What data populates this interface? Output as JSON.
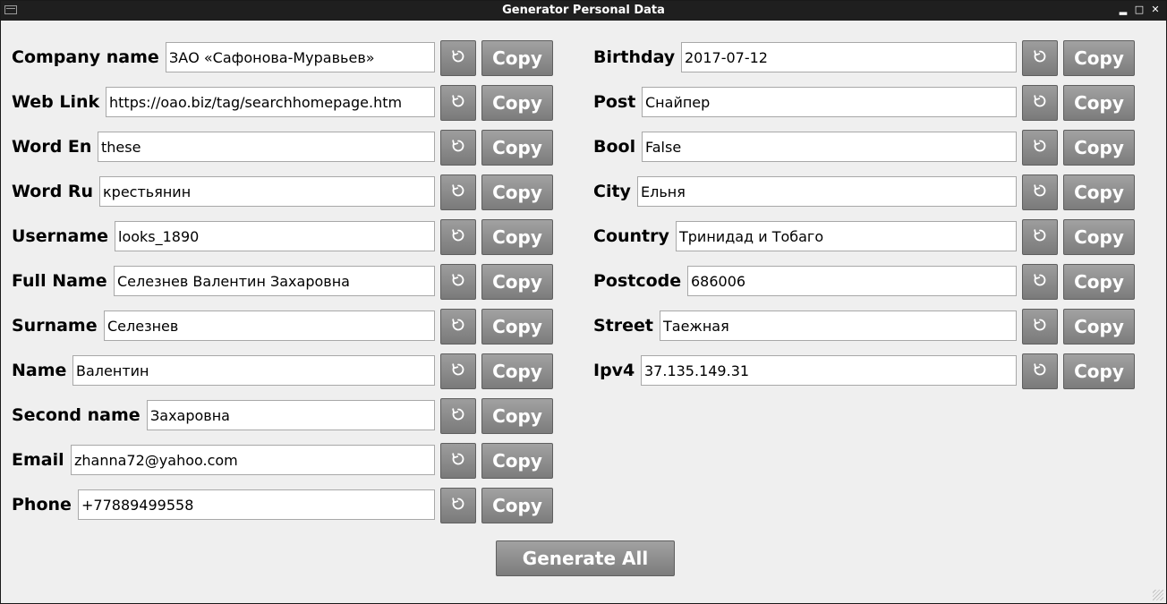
{
  "window": {
    "title": "Generator Personal Data"
  },
  "copy_label": "Copy",
  "generate_all_label": "Generate All",
  "left_fields": [
    {
      "label": "Company name",
      "value": "ЗАО «Сафонова-Муравьев»"
    },
    {
      "label": "Web Link",
      "value": "https://oao.biz/tag/searchhomepage.htm"
    },
    {
      "label": "Word En",
      "value": "these"
    },
    {
      "label": "Word Ru",
      "value": "крестьянин"
    },
    {
      "label": "Username",
      "value": "looks_1890"
    },
    {
      "label": "Full Name",
      "value": "Селезнев Валентин Захаровна"
    },
    {
      "label": "Surname",
      "value": "Селезнев"
    },
    {
      "label": "Name",
      "value": "Валентин"
    },
    {
      "label": "Second name",
      "value": "Захаровна"
    },
    {
      "label": "Email",
      "value": "zhanna72@yahoo.com"
    },
    {
      "label": "Phone",
      "value": "+77889499558"
    }
  ],
  "right_fields": [
    {
      "label": "Birthday",
      "value": "2017-07-12"
    },
    {
      "label": "Post",
      "value": "Снайпер"
    },
    {
      "label": "Bool",
      "value": "False"
    },
    {
      "label": "City",
      "value": "Ельня"
    },
    {
      "label": "Country",
      "value": "Тринидад и Тобаго"
    },
    {
      "label": "Postcode",
      "value": "686006"
    },
    {
      "label": "Street",
      "value": "Таежная"
    },
    {
      "label": "Ipv4",
      "value": "37.135.149.31"
    }
  ]
}
